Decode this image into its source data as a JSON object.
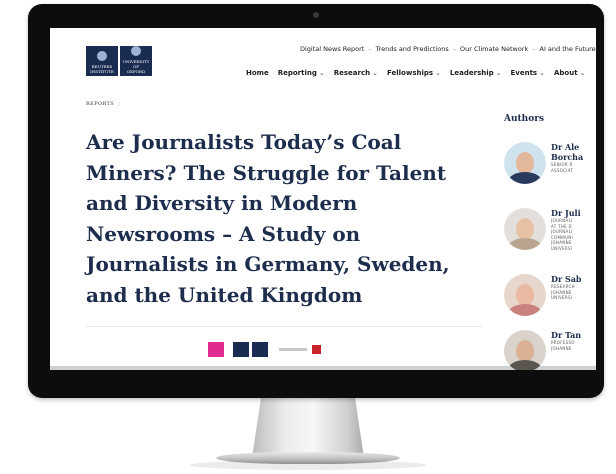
{
  "site": {
    "logo_left": [
      "REUTERS",
      "INSTITUTE"
    ],
    "logo_right": [
      "UNIVERSITY OF",
      "OXFORD"
    ]
  },
  "top_links": [
    "Digital News Report",
    "Trends and Predictions",
    "Our Climate Network",
    "AI and the Future of News"
  ],
  "top_links_separator": "–",
  "main_nav": [
    {
      "label": "Home",
      "dropdown": false
    },
    {
      "label": "Reporting",
      "dropdown": true
    },
    {
      "label": "Research",
      "dropdown": true
    },
    {
      "label": "Fellowships",
      "dropdown": true
    },
    {
      "label": "Leadership",
      "dropdown": true
    },
    {
      "label": "Events",
      "dropdown": true
    },
    {
      "label": "About",
      "dropdown": true
    }
  ],
  "breadcrumb": "REPORTS",
  "article": {
    "title": "Are Journalists Today’s Coal Miners? The Struggle for Talent and Diversity in Modern Newsrooms – A Study on Journalists in Germany, Sweden, and the United Kingdom"
  },
  "sidebar": {
    "heading": "Authors",
    "authors": [
      {
        "name": "Dr Ale",
        "name2": "Borcha",
        "role": [
          "SENIOR R",
          "ASSOCIAT"
        ]
      },
      {
        "name": "Dr Juli",
        "name2": "",
        "role": [
          "JOURNALI",
          "AT THE D",
          "JOURNALI",
          "COMMUNI",
          "JOHANNE",
          "UNIVERSI"
        ]
      },
      {
        "name": "Dr Sab",
        "name2": "",
        "role": [
          "RESEARCH",
          "JOHANNE",
          "UNIVERSI"
        ]
      },
      {
        "name": "Dr Tan",
        "name2": "",
        "role": [
          "PROFESSO",
          "JOHANNE"
        ]
      }
    ]
  },
  "colors": {
    "brand_navy": "#1b2c52",
    "title_text": "#1d2d4d",
    "partner_pink": "#e12b8f",
    "partner_red": "#c8222d"
  }
}
